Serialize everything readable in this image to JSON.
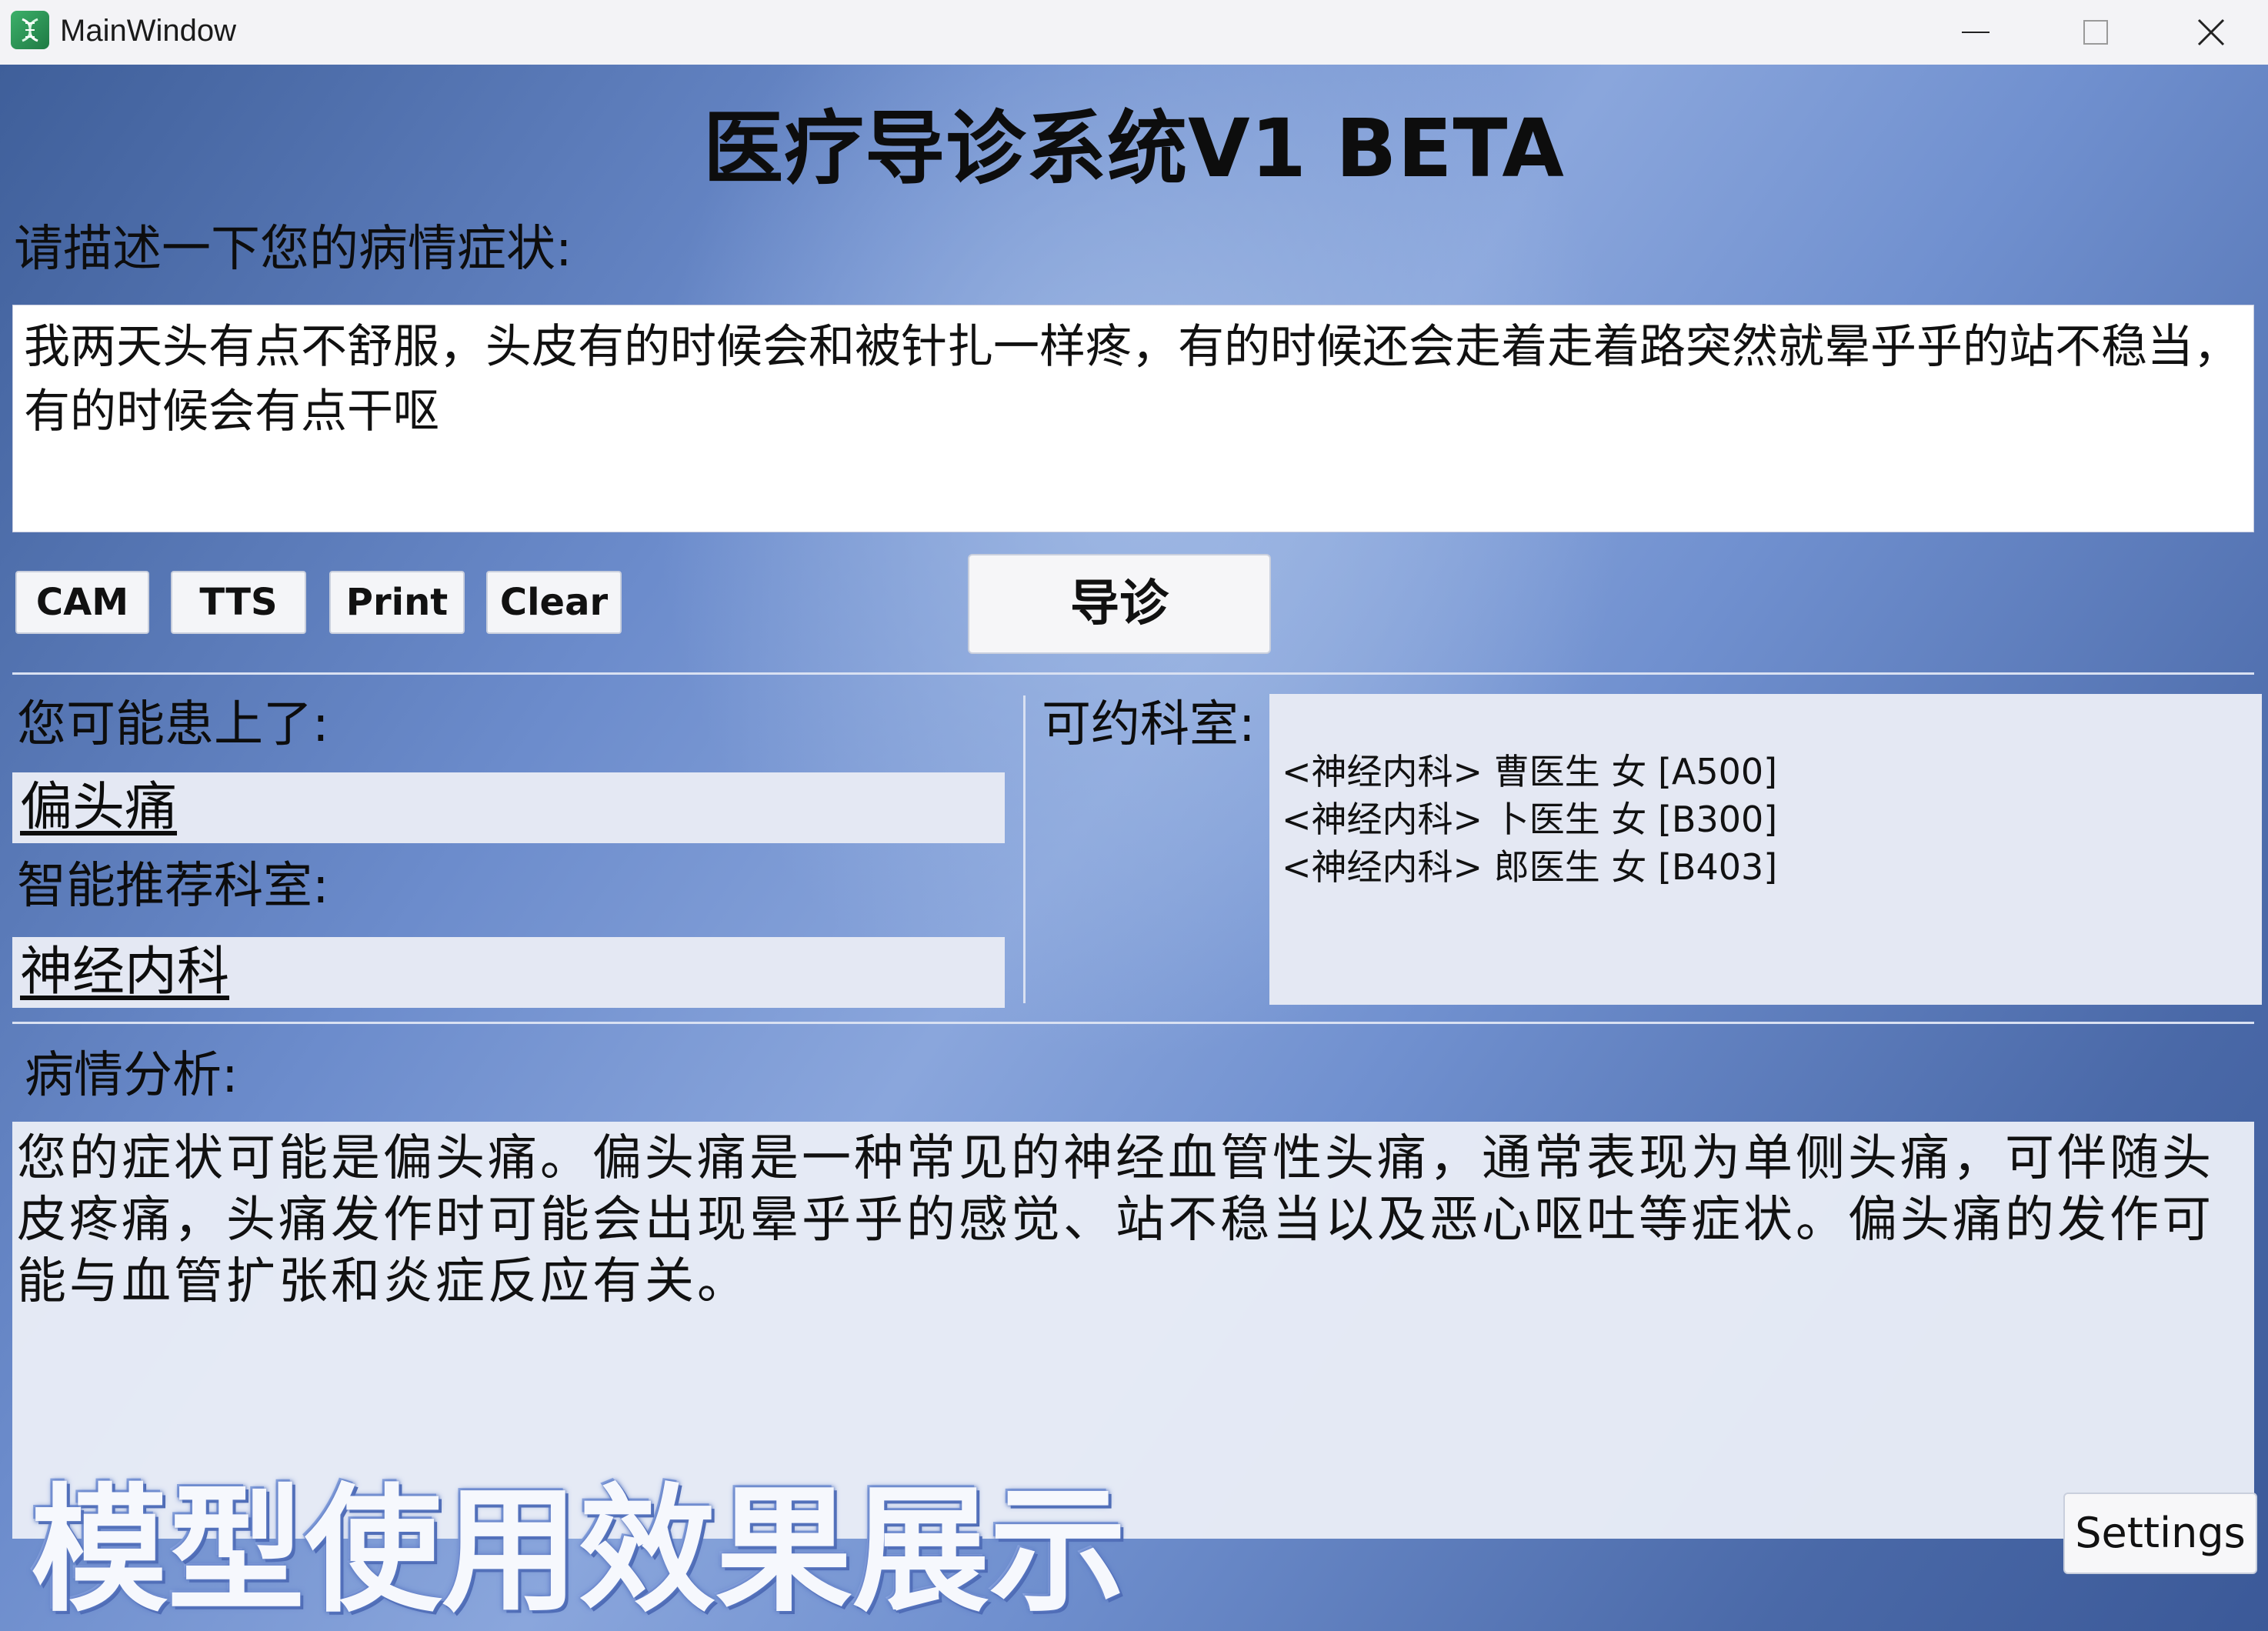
{
  "window": {
    "title": "MainWindow"
  },
  "header": {
    "app_title": "医疗导诊系统V1 BETA"
  },
  "symptom": {
    "prompt": "请描述一下您的病情症状:",
    "input_value": "我两天头有点不舒服，头皮有的时候会和被针扎一样疼，有的时候还会走着走着路突然就晕乎乎的站不稳当，有的时候会有点干呕"
  },
  "toolbar": {
    "cam_label": "CAM",
    "tts_label": "TTS",
    "print_label": "Print",
    "clear_label": "Clear",
    "guide_label": "导诊"
  },
  "results": {
    "diagnosis_label": "您可能患上了:",
    "diagnosis_value": "偏头痛",
    "dept_label": "智能推荐科室:",
    "dept_value": "神经内科"
  },
  "available": {
    "label": "可约科室:",
    "doctors": [
      "<神经内科> 曹医生 女 [A500]",
      "<神经内科> 卜医生 女 [B300]",
      "<神经内科> 郎医生 女 [B403]"
    ]
  },
  "analysis": {
    "label": "病情分析:",
    "text": "您的症状可能是偏头痛。偏头痛是一种常见的神经血管性头痛，通常表现为单侧头痛，可伴随头皮疼痛，头痛发作时可能会出现晕乎乎的感觉、站不稳当以及恶心呕吐等症状。偏头痛的发作可能与血管扩张和炎症反应有关。"
  },
  "footer": {
    "caption": "模型使用效果展示",
    "settings_label": "Settings"
  },
  "icons": {
    "app": "dna-icon",
    "minimize": "minimize-icon",
    "maximize": "maximize-icon",
    "close": "close-icon"
  }
}
